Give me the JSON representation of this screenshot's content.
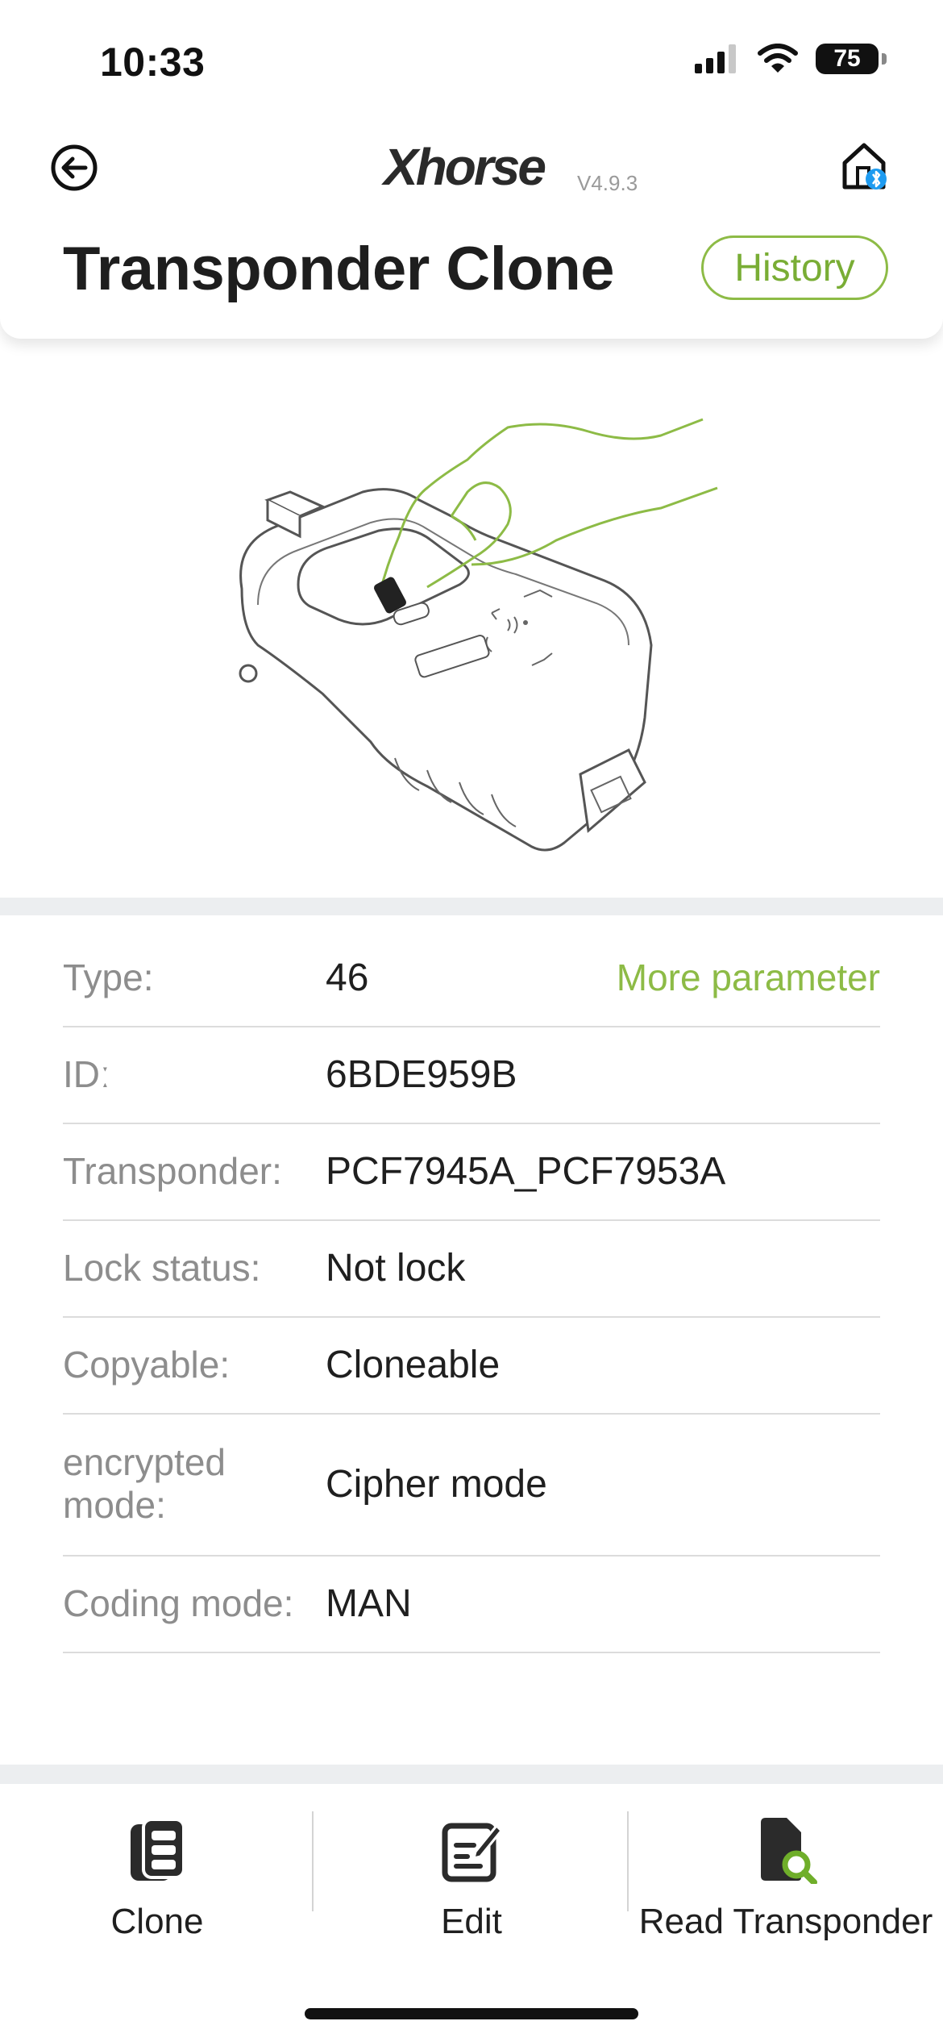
{
  "status_bar": {
    "time": "10:33",
    "battery": "75"
  },
  "header": {
    "logo": "Xhorse",
    "version": "V4.9.3",
    "title": "Transponder Clone",
    "history_label": "History"
  },
  "info": {
    "more_parameter": "More parameter",
    "rows": [
      {
        "label": "Type:",
        "value": "46"
      },
      {
        "label": "IDː",
        "value": "6BDE959B"
      },
      {
        "label": "Transponder:",
        "value": "PCF7945A_PCF7953A"
      },
      {
        "label": "Lock status:",
        "value": "Not lock"
      },
      {
        "label": "Copyable:",
        "value": "Cloneable"
      },
      {
        "label": "encrypted mode:",
        "value": "Cipher mode"
      },
      {
        "label": "Coding mode:",
        "value": "MAN"
      }
    ]
  },
  "bottom_bar": {
    "tabs": [
      {
        "label": "Clone",
        "icon": "key-remote-icon"
      },
      {
        "label": "Edit",
        "icon": "edit-icon"
      },
      {
        "label": "Read Transponder",
        "icon": "read-transponder-icon"
      }
    ]
  },
  "colors": {
    "accent_green": "#8dbb46",
    "divider": "#eceef0",
    "bluetooth_blue": "#1e9bf0"
  }
}
